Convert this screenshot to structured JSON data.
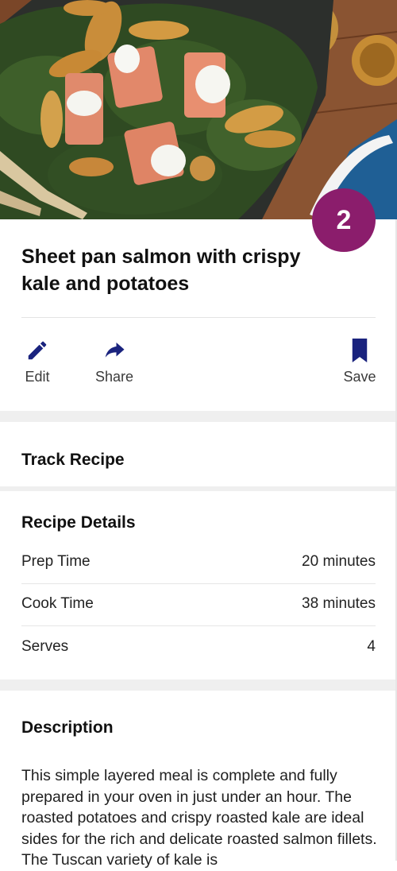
{
  "recipe": {
    "title": "Sheet pan salmon with crispy kale and potatoes",
    "points": "2"
  },
  "actions": {
    "edit": {
      "label": "Edit",
      "icon": "pencil-icon"
    },
    "share": {
      "label": "Share",
      "icon": "share-arrow-icon"
    },
    "save": {
      "label": "Save",
      "icon": "bookmark-icon"
    }
  },
  "track": {
    "heading": "Track Recipe"
  },
  "details": {
    "heading": "Recipe Details",
    "rows": [
      {
        "label": "Prep Time",
        "value": "20 minutes"
      },
      {
        "label": "Cook Time",
        "value": "38 minutes"
      },
      {
        "label": "Serves",
        "value": "4"
      }
    ]
  },
  "description": {
    "heading": "Description",
    "text": "This simple layered meal is complete and fully prepared in your oven in just under an hour. The roasted potatoes and crispy roasted kale are ideal sides for the rich and delicate roasted salmon fillets. The Tuscan variety of kale is"
  },
  "colors": {
    "accent": "#1a237e",
    "badge": "#8b1d6c",
    "band": "#efefef"
  }
}
